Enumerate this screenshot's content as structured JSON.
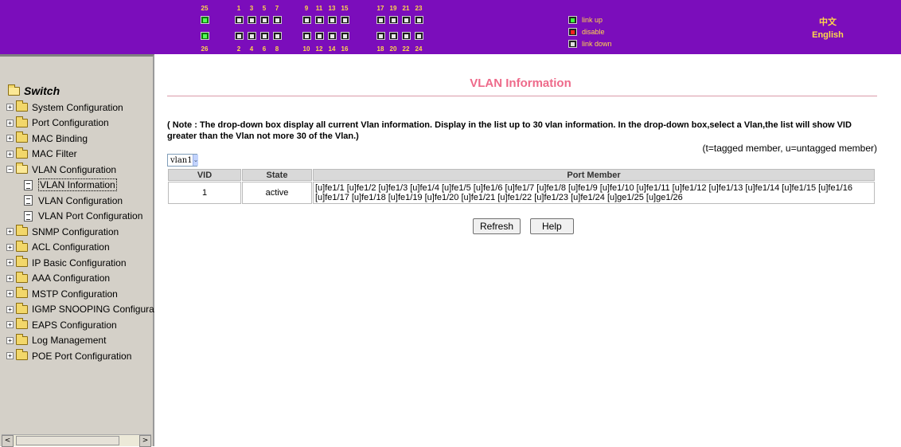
{
  "banner": {
    "top_port_numbers": [
      "25",
      "1",
      "3",
      "5",
      "7",
      "9",
      "11",
      "13",
      "15",
      "17",
      "19",
      "21",
      "23"
    ],
    "bottom_port_numbers": [
      "26",
      "2",
      "4",
      "6",
      "8",
      "10",
      "12",
      "14",
      "16",
      "18",
      "20",
      "22",
      "24"
    ],
    "legend": {
      "link_up": "link up",
      "disable": "disable",
      "link_down": "link down"
    },
    "lang_cn": "中文",
    "lang_en": "English",
    "colors": {
      "background": "#7b0dbb",
      "text": "#ffd84a"
    }
  },
  "nav": {
    "root": "Switch",
    "items": [
      {
        "label": "System Configuration"
      },
      {
        "label": "Port Configuration"
      },
      {
        "label": "MAC Binding"
      },
      {
        "label": "MAC Filter"
      },
      {
        "label": "VLAN Configuration"
      },
      {
        "label": "VLAN Information"
      },
      {
        "label": "VLAN Configuration"
      },
      {
        "label": "VLAN Port Configuration"
      },
      {
        "label": "SNMP Configuration"
      },
      {
        "label": "ACL Configuration"
      },
      {
        "label": "IP Basic Configuration"
      },
      {
        "label": "AAA Configuration"
      },
      {
        "label": "MSTP Configuration"
      },
      {
        "label": "IGMP SNOOPING Configura"
      },
      {
        "label": "EAPS Configuration"
      },
      {
        "label": "Log Management"
      },
      {
        "label": "POE Port Configuration"
      }
    ],
    "scroll_left": "<",
    "scroll_right": ">"
  },
  "main": {
    "title": "VLAN Information",
    "note": "( Note : The drop-down box display all current Vlan information. Display in the list up to 30 vlan information. In the drop-down box,select a Vlan,the list will show VID greater than the Vlan not more 30 of the Vlan.)",
    "legend_note": "(t=tagged member, u=untagged member)",
    "vlan_select": {
      "value": "vlan1",
      "arrow": "⌄"
    },
    "table": {
      "headers": {
        "vid": "VID",
        "state": "State",
        "port_member": "Port Member"
      },
      "rows": [
        {
          "vid": "1",
          "state": "active",
          "port_member": "[u]fe1/1 [u]fe1/2 [u]fe1/3 [u]fe1/4 [u]fe1/5 [u]fe1/6 [u]fe1/7 [u]fe1/8 [u]fe1/9 [u]fe1/10 [u]fe1/11 [u]fe1/12 [u]fe1/13 [u]fe1/14 [u]fe1/15 [u]fe1/16 [u]fe1/17 [u]fe1/18 [u]fe1/19 [u]fe1/20 [u]fe1/21 [u]fe1/22 [u]fe1/23 [u]fe1/24 [u]ge1/25 [u]ge1/26"
        }
      ]
    },
    "buttons": {
      "refresh": "Refresh",
      "help": "Help"
    },
    "colors": {
      "title": "#ee6a8a"
    }
  }
}
